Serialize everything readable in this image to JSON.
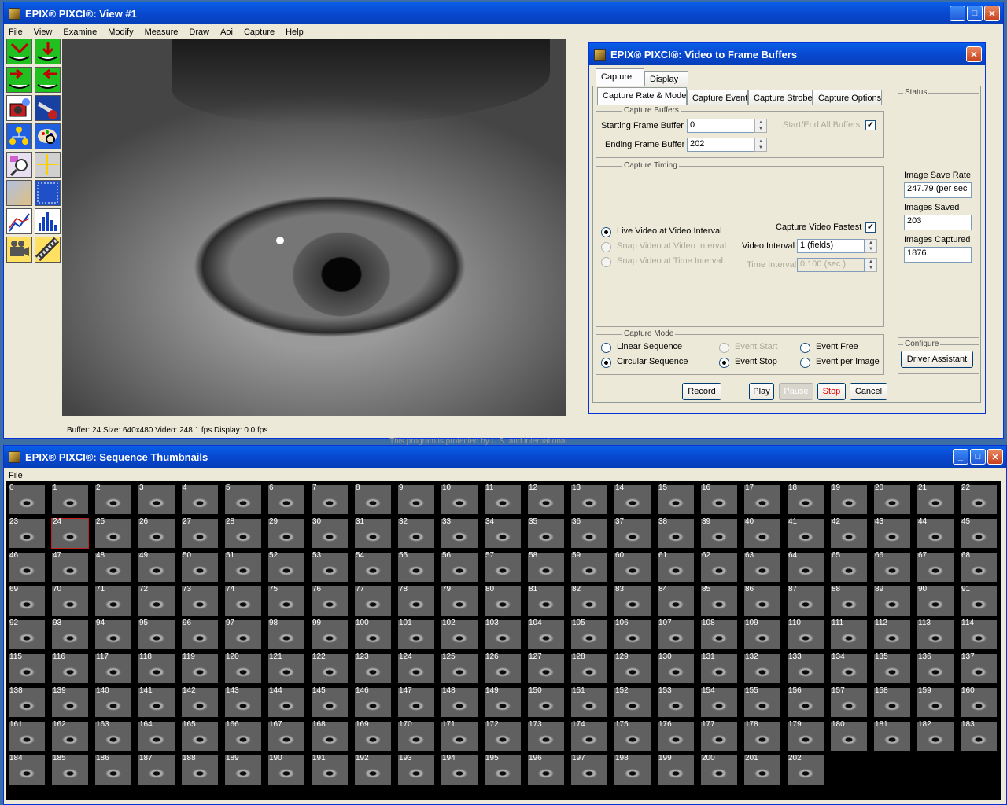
{
  "view_window": {
    "title": "EPIX® PIXCI®: View #1",
    "menu": [
      "File",
      "View",
      "Examine",
      "Modify",
      "Measure",
      "Draw",
      "Aoi",
      "Capture",
      "Help"
    ],
    "tools": [
      "capture-snap-icon",
      "capture-live-icon",
      "load-image-icon",
      "save-image-icon",
      "camera-icon",
      "telescope-icon",
      "family-icon",
      "palette-icon",
      "magnifier-icon",
      "crosshair-icon",
      "pattern-icon",
      "grid-icon",
      "line-graph-icon",
      "histogram-icon",
      "video-camera-icon",
      "film-strip-icon"
    ],
    "status": "Buffer: 24  Size: 640x480  Video: 248.1 fps  Display: 0.0 fps",
    "background_text": "This program is protected by U.S. and international"
  },
  "capture_dialog": {
    "title": "EPIX® PIXCI®: Video to Frame Buffers",
    "top_tabs": [
      "Capture",
      "Display"
    ],
    "sub_tabs": [
      "Capture Rate & Mode",
      "Capture Event",
      "Capture Strobe",
      "Capture Options"
    ],
    "buffers": {
      "legend": "Capture Buffers",
      "start_label": "Starting Frame Buffer",
      "start_value": "0",
      "end_label": "Ending Frame Buffer",
      "end_value": "202",
      "all_label": "Start/End All Buffers"
    },
    "timing": {
      "legend": "Capture Timing",
      "radio_live": "Live Video at Video Interval",
      "radio_snap_video": "Snap Video at Video Interval",
      "radio_snap_time": "Snap Video at Time Interval",
      "fastest_label": "Capture Video Fastest",
      "video_interval_label": "Video Interval",
      "video_interval_value": "1 (fields)",
      "time_interval_label": "Time Interval",
      "time_interval_value": "0.100 (sec.)"
    },
    "mode": {
      "legend": "Capture Mode",
      "linear": "Linear Sequence",
      "circular": "Circular Sequence",
      "event_start": "Event Start",
      "event_stop": "Event Stop",
      "event_free": "Event Free",
      "event_per_image": "Event per Image"
    },
    "status": {
      "legend": "Status",
      "save_rate_label": "Image Save Rate",
      "save_rate_value": "247.79 (per sec",
      "saved_label": "Images Saved",
      "saved_value": "203",
      "captured_label": "Images Captured",
      "captured_value": "1876"
    },
    "configure": {
      "legend": "Configure",
      "button": "Driver Assistant"
    },
    "buttons": {
      "record": "Record",
      "play": "Play",
      "pause": "Pause",
      "stop": "Stop",
      "cancel": "Cancel"
    },
    "colors": {
      "stop": "#e00000"
    }
  },
  "thumbs_window": {
    "title": "EPIX® PIXCI®: Sequence Thumbnails",
    "menu": [
      "File"
    ],
    "count": 203,
    "per_row": 23,
    "selected": 24,
    "labels": [
      "0",
      "1",
      "2",
      "3",
      "4",
      "5",
      "6",
      "7",
      "8",
      "9",
      "10",
      "11",
      "12",
      "13",
      "14",
      "15",
      "16",
      "17",
      "18",
      "19",
      "20",
      "21",
      "22",
      "23",
      "24",
      "25",
      "26",
      "27",
      "28",
      "29",
      "30",
      "31",
      "32",
      "33",
      "34",
      "35",
      "36",
      "37",
      "38",
      "39",
      "40",
      "41",
      "42",
      "43",
      "44",
      "45",
      "46",
      "47",
      "48",
      "49",
      "50",
      "51",
      "52",
      "53",
      "54",
      "55",
      "56",
      "57",
      "58",
      "59",
      "60",
      "61",
      "62",
      "63",
      "64",
      "65",
      "66",
      "67",
      "68",
      "69",
      "70",
      "71",
      "72",
      "73",
      "74",
      "75",
      "76",
      "77",
      "78",
      "79",
      "80",
      "81",
      "82",
      "83",
      "84",
      "85",
      "86",
      "87",
      "88",
      "89",
      "90",
      "91",
      "92",
      "93",
      "94",
      "95",
      "96",
      "97",
      "98",
      "99",
      "100",
      "101",
      "102",
      "103",
      "104",
      "105",
      "106",
      "107",
      "108",
      "109",
      "110",
      "111",
      "112",
      "113",
      "114",
      "115",
      "116",
      "117",
      "118",
      "119",
      "120",
      "121",
      "122",
      "123",
      "124",
      "125",
      "126",
      "127",
      "128",
      "129",
      "130",
      "131",
      "132",
      "133",
      "134",
      "135",
      "136",
      "137",
      "138",
      "139",
      "140",
      "141",
      "142",
      "143",
      "144",
      "145",
      "146",
      "147",
      "148",
      "149",
      "150",
      "151",
      "152",
      "153",
      "154",
      "155",
      "156",
      "157",
      "158",
      "159",
      "160",
      "161",
      "162",
      "163",
      "164",
      "165",
      "166",
      "167",
      "168",
      "169",
      "170",
      "171",
      "172",
      "173",
      "174",
      "175",
      "176",
      "177",
      "178",
      "179",
      "180",
      "181",
      "182",
      "183",
      "184",
      "185",
      "186",
      "187",
      "188",
      "189",
      "190",
      "191",
      "192",
      "193",
      "194",
      "195",
      "196",
      "197",
      "198",
      "199",
      "200",
      "201",
      "202"
    ]
  }
}
